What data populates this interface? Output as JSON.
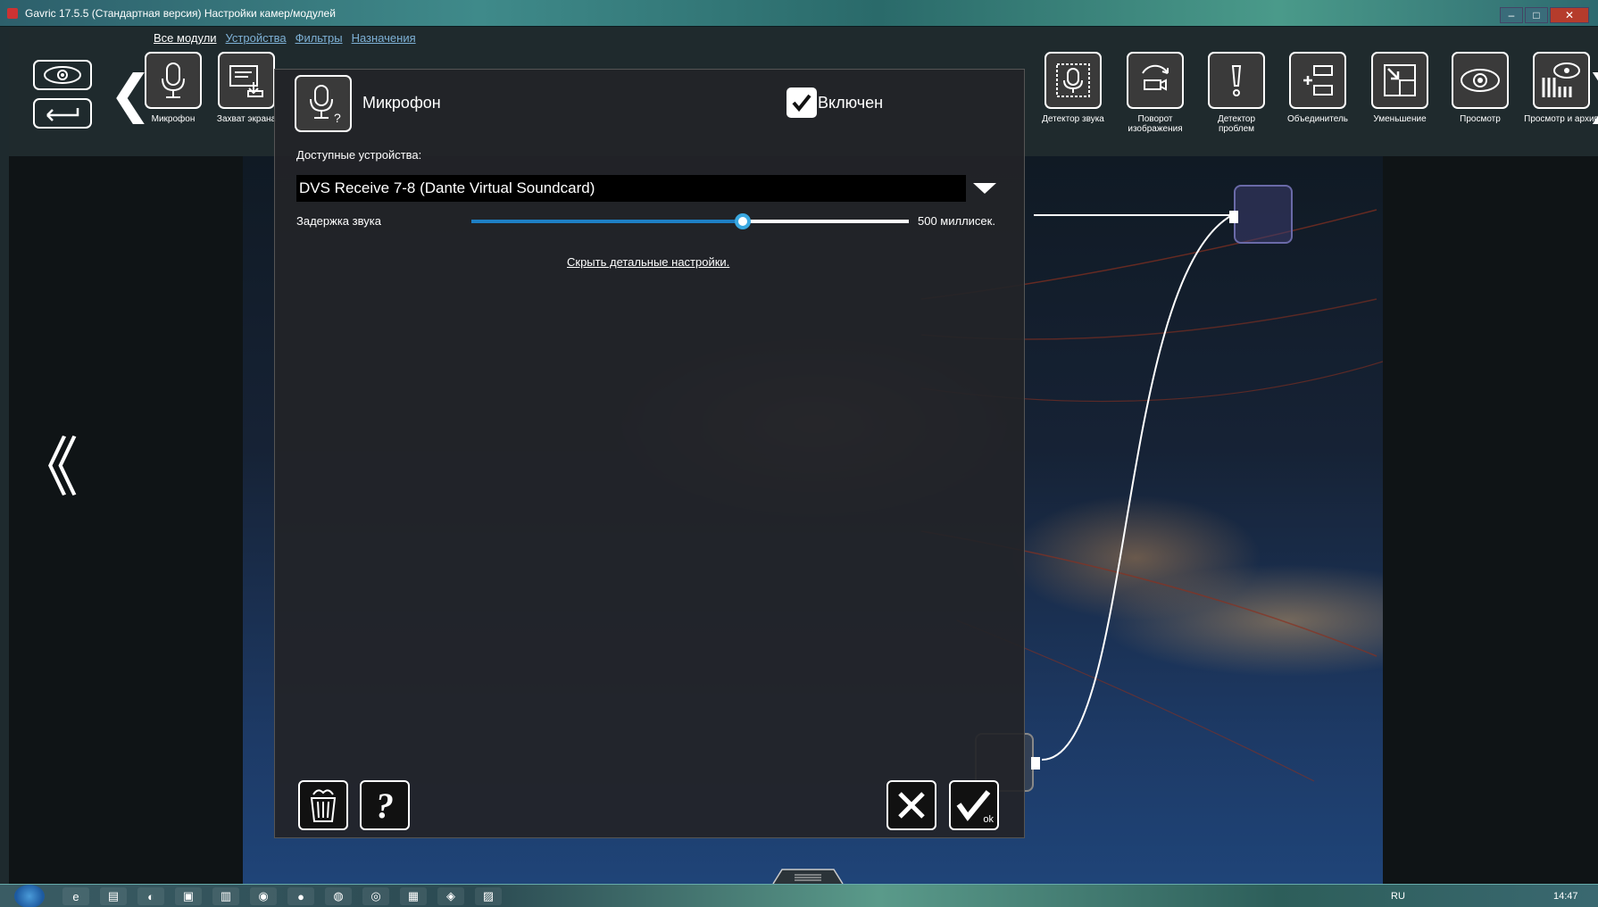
{
  "window": {
    "title": "Gavric 17.5.5 (Стандартная версия) Настройки камер/модулей",
    "minimize": "‒",
    "maximize": "□",
    "close": "✕"
  },
  "tabs": [
    {
      "label": "Все модули"
    },
    {
      "label": "Устройства"
    },
    {
      "label": "Фильтры"
    },
    {
      "label": "Назначения"
    }
  ],
  "toolbar": {
    "nav_prev": "❮",
    "nav_next": "❯",
    "modules": [
      {
        "label": "Микрофон",
        "icon": "microphone-icon"
      },
      {
        "label": "Захват экрана",
        "icon": "screen-capture-icon"
      },
      {
        "label": "Детектор звука",
        "icon": "sound-detector-icon"
      },
      {
        "label": "Поворот изображения",
        "icon": "rotate-image-icon"
      },
      {
        "label": "Детектор проблем",
        "icon": "problem-detector-icon"
      },
      {
        "label": "Объединитель",
        "icon": "merger-icon"
      },
      {
        "label": "Уменьшение",
        "icon": "downscale-icon"
      },
      {
        "label": "Просмотр",
        "icon": "view-icon"
      },
      {
        "label": "Просмотр и архив",
        "icon": "view-archive-icon"
      }
    ]
  },
  "workspace": {
    "nav_left": "《"
  },
  "modal": {
    "title": "Микрофон",
    "enabled_label": "Включен",
    "enabled": true,
    "devices_label": "Доступные устройства:",
    "device_value": "DVS Receive  7-8 (Dante Virtual Soundcard)",
    "delay_label": "Задержка звука",
    "delay_value": "500 миллисек.",
    "delay_fraction": 0.62,
    "hide_settings_link": "Скрыть детальные настройки.",
    "ok_sub": "ok",
    "help_glyph": "?"
  },
  "taskbar": {
    "language": "RU",
    "clock": "14:47"
  }
}
